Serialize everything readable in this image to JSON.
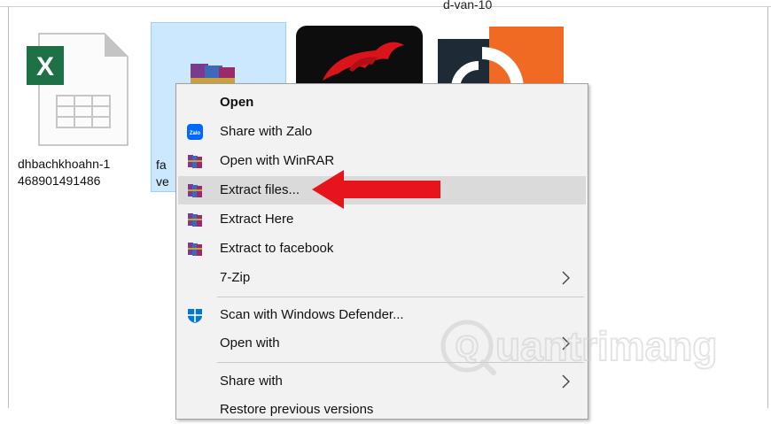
{
  "folder": {
    "top_label": "d-van-10"
  },
  "files": {
    "excel": {
      "line1": "dhbachkhoahn-1",
      "line2": "468901491486",
      "icon": "excel-file-icon",
      "badge": "X"
    },
    "rar": {
      "line1": "fa",
      "line2": "ve",
      "icon": "winrar-archive-icon"
    }
  },
  "context_menu": {
    "items": [
      {
        "label": "Open",
        "icon": ""
      },
      {
        "label": "Share with Zalo",
        "icon": "zalo-icon"
      },
      {
        "label": "Open with WinRAR",
        "icon": "winrar-icon"
      },
      {
        "label": "Extract files...",
        "icon": "winrar-icon"
      },
      {
        "label": "Extract Here",
        "icon": "winrar-icon"
      },
      {
        "label": "Extract to facebook",
        "icon": "winrar-icon"
      },
      {
        "label": "7-Zip",
        "icon": "",
        "submenu": true
      },
      {
        "label": "Scan with Windows Defender...",
        "icon": "windows-defender-icon"
      },
      {
        "label": "Open with",
        "icon": "",
        "submenu": true
      },
      {
        "label": "Share with",
        "icon": "",
        "submenu": true
      },
      {
        "label": "Restore previous versions",
        "icon": ""
      }
    ],
    "highlighted": "Extract files..."
  },
  "zalo_icon_text": "Zalo",
  "watermark": {
    "text": "uantrimang",
    "logo": "Q"
  },
  "colors": {
    "selection": "#cce8ff",
    "highlight": "#dadada",
    "arrow": "#e8141c",
    "excel_green": "#1e7145",
    "zalo_blue": "#0068ff",
    "defender_blue": "#0078d7"
  }
}
